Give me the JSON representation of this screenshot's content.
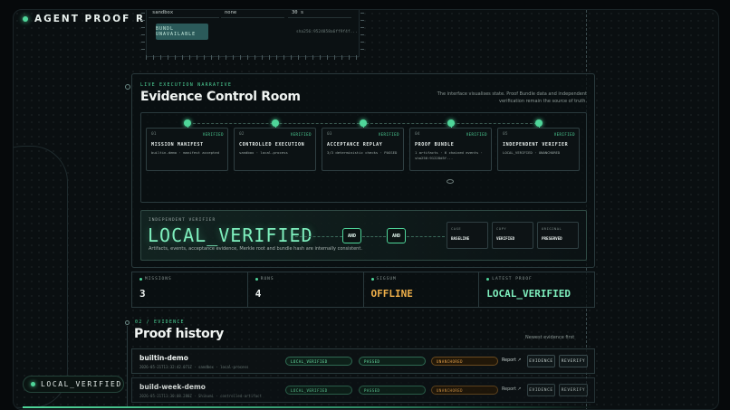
{
  "brand": {
    "title": "AGENT PROOF RUNTIME"
  },
  "top_panel": {
    "cell_1": "sandbox",
    "cell_2": "none",
    "cell_3": "30 s",
    "button_label": "BUNDL UNAVAILABLE",
    "hash": "sha256:9524858a6ff9f4f..."
  },
  "narrative": {
    "eyebrow": "LIVE EXECUTION NARRATIVE",
    "title": "Evidence Control Room",
    "description": "The interface visualises state. Proof Bundle data and independent verification remain the source of truth.",
    "steps": [
      {
        "num": "01",
        "badge": "VERIFIED",
        "name": "MISSION MANIFEST",
        "detail": "builtin-demo · manifest accepted"
      },
      {
        "num": "02",
        "badge": "VERIFIED",
        "name": "CONTROLLED EXECUTION",
        "detail": "sandbox · local-process"
      },
      {
        "num": "03",
        "badge": "VERIFIED",
        "name": "ACCEPTANCE REPLAY",
        "detail": "3/3 deterministic checks · PASSED"
      },
      {
        "num": "04",
        "badge": "VERIFIED",
        "name": "PROOF BUNDLE",
        "detail": "1 artifacts · 6 chained events · sha256:91228d5f..."
      },
      {
        "num": "05",
        "badge": "VERIFIED",
        "name": "INDEPENDENT VERIFIER",
        "detail": "LOCAL_VERIFIED · UNANCHORED"
      }
    ]
  },
  "verifier": {
    "eyebrow": "INDEPENDENT VERIFIER",
    "status": "LOCAL_VERIFIED",
    "subtitle": "Artifacts, events, acceptance evidence, Merkle root and bundle hash are internally consistent.",
    "gate_1": "AND",
    "gate_2": "AND",
    "cards": [
      {
        "key": "CASE",
        "value": "BASELINE"
      },
      {
        "key": "COPY",
        "value": "VERIFIED"
      },
      {
        "key": "ORIGINAL",
        "value": "PRESERVED"
      }
    ]
  },
  "stats": [
    {
      "label": "MISSIONS",
      "value": "3",
      "color": "#eef3f1"
    },
    {
      "label": "RUNS",
      "value": "4",
      "color": "#eef3f1"
    },
    {
      "label": "SIGSUM",
      "value": "OFFLINE",
      "color": "#f0b04a"
    },
    {
      "label": "LATEST PROOF",
      "value": "LOCAL_VERIFIED",
      "color": "#7ff0be"
    }
  ],
  "history": {
    "eyebrow": "02 / EVIDENCE",
    "title": "Proof history",
    "side_note": "Newest evidence first",
    "rows": [
      {
        "name": "builtin-demo",
        "meta": "2026-05-21T11:32:42.071Z · sandbox · local-process",
        "status": "LOCAL_VERIFIED",
        "result": "PASSED",
        "anchor": "UNANCHORED",
        "report": "Report ↗",
        "evidence": "EVIDENCE",
        "reverify": "REVERIFY"
      },
      {
        "name": "build-week-demo",
        "meta": "2026-05-21T11:30:08.280Z · Shikumi · controlled-artifact",
        "status": "LOCAL_VERIFIED",
        "result": "PASSED",
        "anchor": "UNANCHORED",
        "report": "Report ↗",
        "evidence": "EVIDENCE",
        "reverify": "REVERIFY"
      }
    ]
  },
  "status_pill": {
    "label": "LOCAL_VERIFIED"
  },
  "colors": {
    "accent": "#4fd69a",
    "warning": "#f0b04a",
    "background": "#0a0f11"
  }
}
